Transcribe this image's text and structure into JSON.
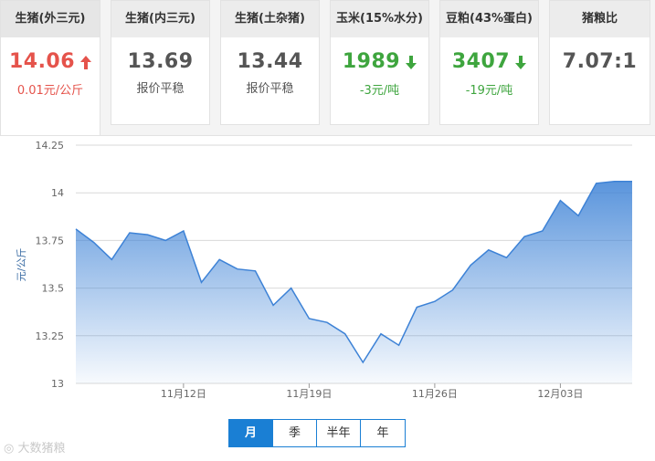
{
  "cards": [
    {
      "title": "生猪(外三元)",
      "value": "14.06",
      "sub": "0.01元/公斤",
      "trend": "up"
    },
    {
      "title": "生猪(内三元)",
      "value": "13.69",
      "sub": "报价平稳",
      "trend": "flat"
    },
    {
      "title": "生猪(土杂猪)",
      "value": "13.44",
      "sub": "报价平稳",
      "trend": "flat"
    },
    {
      "title": "玉米(15%水分)",
      "value": "1989",
      "sub": "-3元/吨",
      "trend": "down"
    },
    {
      "title": "豆粕(43%蛋白)",
      "value": "3407",
      "sub": "-19元/吨",
      "trend": "down"
    },
    {
      "title": "猪粮比",
      "value": "7.07:1",
      "sub": "",
      "trend": "flat"
    }
  ],
  "colors": {
    "up": "#e5534b",
    "down": "#3ea53e",
    "accent": "#1a7fd4",
    "line": "#3d82d6"
  },
  "chart_data": {
    "type": "area",
    "ylabel": "元/公斤",
    "xlabel": "",
    "title": "",
    "ylim": [
      13,
      14.25
    ],
    "yticks": [
      "14.25",
      "14",
      "13.75",
      "13.5",
      "13.25",
      "13"
    ],
    "xticks": [
      {
        "label": "11月12日",
        "index": 6
      },
      {
        "label": "11月19日",
        "index": 13
      },
      {
        "label": "11月26日",
        "index": 20
      },
      {
        "label": "12月03日",
        "index": 27
      }
    ],
    "x": [
      "11-06",
      "11-07",
      "11-08",
      "11-09",
      "11-10",
      "11-11",
      "11-12",
      "11-13",
      "11-14",
      "11-15",
      "11-16",
      "11-17",
      "11-18",
      "11-19",
      "11-20",
      "11-21",
      "11-22",
      "11-23",
      "11-24",
      "11-25",
      "11-26",
      "11-27",
      "11-28",
      "11-29",
      "11-30",
      "12-01",
      "12-02",
      "12-03",
      "12-04",
      "12-05",
      "12-06",
      "12-07"
    ],
    "values": [
      13.81,
      13.74,
      13.65,
      13.79,
      13.78,
      13.75,
      13.8,
      13.53,
      13.65,
      13.6,
      13.59,
      13.41,
      13.5,
      13.34,
      13.32,
      13.26,
      13.11,
      13.26,
      13.2,
      13.4,
      13.43,
      13.49,
      13.62,
      13.7,
      13.66,
      13.77,
      13.8,
      13.96,
      13.88,
      14.05,
      14.06,
      14.06
    ],
    "grid": true
  },
  "range_buttons": [
    {
      "label": "月",
      "active": true
    },
    {
      "label": "季",
      "active": false
    },
    {
      "label": "半年",
      "active": false
    },
    {
      "label": "年",
      "active": false
    }
  ],
  "watermark": "大数猪粮"
}
